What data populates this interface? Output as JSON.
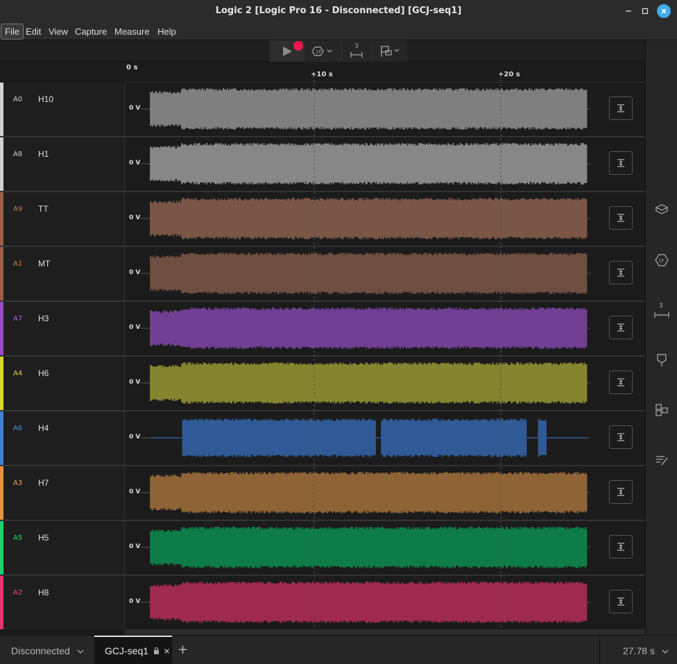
{
  "window": {
    "title": "Logic 2 [Logic Pro 16 - Disconnected] [GCJ-seq1]",
    "minimize_icon": "minimize-icon",
    "maximize_icon": "maximize-icon",
    "close_icon": "close-icon"
  },
  "menu": [
    {
      "label": "File",
      "active": true
    },
    {
      "label": "Edit"
    },
    {
      "label": "View"
    },
    {
      "label": "Capture"
    },
    {
      "label": "Measure"
    },
    {
      "label": "Help"
    }
  ],
  "toolbar": {
    "run_icon": "play-icon",
    "record_color": "#e8174c",
    "trigger_icon": "trigger-icon",
    "measure_label": "3",
    "marker_icon": "marker-icon"
  },
  "ruler": {
    "ticks": [
      "0 s",
      "+10 s",
      "+20 s"
    ]
  },
  "channels": [
    {
      "id": "A0",
      "name": "H10",
      "zero_label": "0 V",
      "color": "#8a8a8a",
      "id_color": "#cfcfcf",
      "bar": "#d0d0d0",
      "wave_color": "#7f7f7f"
    },
    {
      "id": "A8",
      "name": "H1",
      "zero_label": "0 V",
      "color": "#8a8a8a",
      "id_color": "#cfcfcf",
      "bar": "#d0d0d0",
      "wave_color": "#878787"
    },
    {
      "id": "A9",
      "name": "TT",
      "zero_label": "0 V",
      "color": "#a66a52",
      "id_color": "#c07a5e",
      "bar": "#9a5f48",
      "wave_color": "#7a5646"
    },
    {
      "id": "A1",
      "name": "MT",
      "zero_label": "0 V",
      "color": "#a66a52",
      "id_color": "#c07a5e",
      "bar": "#9a5f48",
      "wave_color": "#6e4e40"
    },
    {
      "id": "A7",
      "name": "H3",
      "zero_label": "0 V",
      "color": "#9a49c7",
      "id_color": "#b064e0",
      "bar": "#9a49c7",
      "wave_color": "#703f94"
    },
    {
      "id": "A4",
      "name": "H6",
      "zero_label": "0 V",
      "color": "#d5d52a",
      "id_color": "#d8d83a",
      "bar": "#d5d52a",
      "wave_color": "#85842f"
    },
    {
      "id": "A6",
      "name": "H4",
      "zero_label": "0 V",
      "color": "#3f7fd8",
      "id_color": "#4d8fe8",
      "bar": "#3f7fd8",
      "wave_color": "#2f5a95"
    },
    {
      "id": "A3",
      "name": "H7",
      "zero_label": "0 V",
      "color": "#f09a40",
      "id_color": "#f0a050",
      "bar": "#e8923a",
      "wave_color": "#8e6335"
    },
    {
      "id": "A5",
      "name": "H5",
      "zero_label": "0 V",
      "color": "#1fcf6a",
      "id_color": "#2adf7a",
      "bar": "#1fcf6a",
      "wave_color": "#0e7c47"
    },
    {
      "id": "A2",
      "name": "H8",
      "zero_label": "0 V",
      "color": "#e0356a",
      "id_color": "#f04a7a",
      "bar": "#e0356a",
      "wave_color": "#9e2a4e"
    }
  ],
  "sidebar": [
    {
      "icon": "analyzers-icon"
    },
    {
      "icon": "trigger-icon"
    },
    {
      "icon": "measurements-icon",
      "label": "3"
    },
    {
      "icon": "markers-icon"
    },
    {
      "icon": "extensions-icon"
    },
    {
      "icon": "notes-icon"
    }
  ],
  "status": {
    "connection": "Disconnected",
    "session_tab": "GCJ-seq1",
    "add_tab": "+",
    "capture_length": "27.78 s"
  }
}
